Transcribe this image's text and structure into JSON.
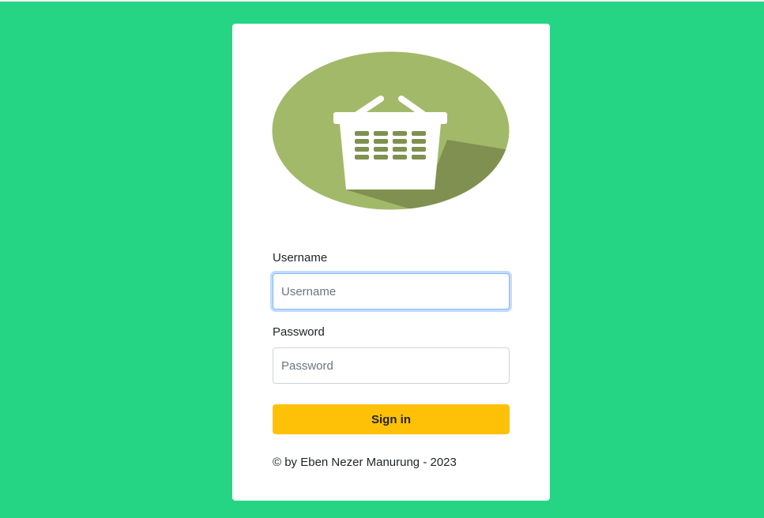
{
  "logo": {
    "icon": "shopping-basket-icon",
    "colors": {
      "ellipse": "#a3b96a",
      "shadow": "#7f9050",
      "basket": "#ffffff",
      "slots": "#7f9050"
    }
  },
  "form": {
    "username": {
      "label": "Username",
      "placeholder": "Username",
      "value": ""
    },
    "password": {
      "label": "Password",
      "placeholder": "Password",
      "value": ""
    },
    "submit_label": "Sign in"
  },
  "footer": {
    "text": "© by Eben Nezer Manurung - 2023"
  },
  "colors": {
    "page_background": "#26d584",
    "card_background": "#ffffff",
    "button": "#ffc107",
    "focus_ring": "#86b7fe"
  }
}
